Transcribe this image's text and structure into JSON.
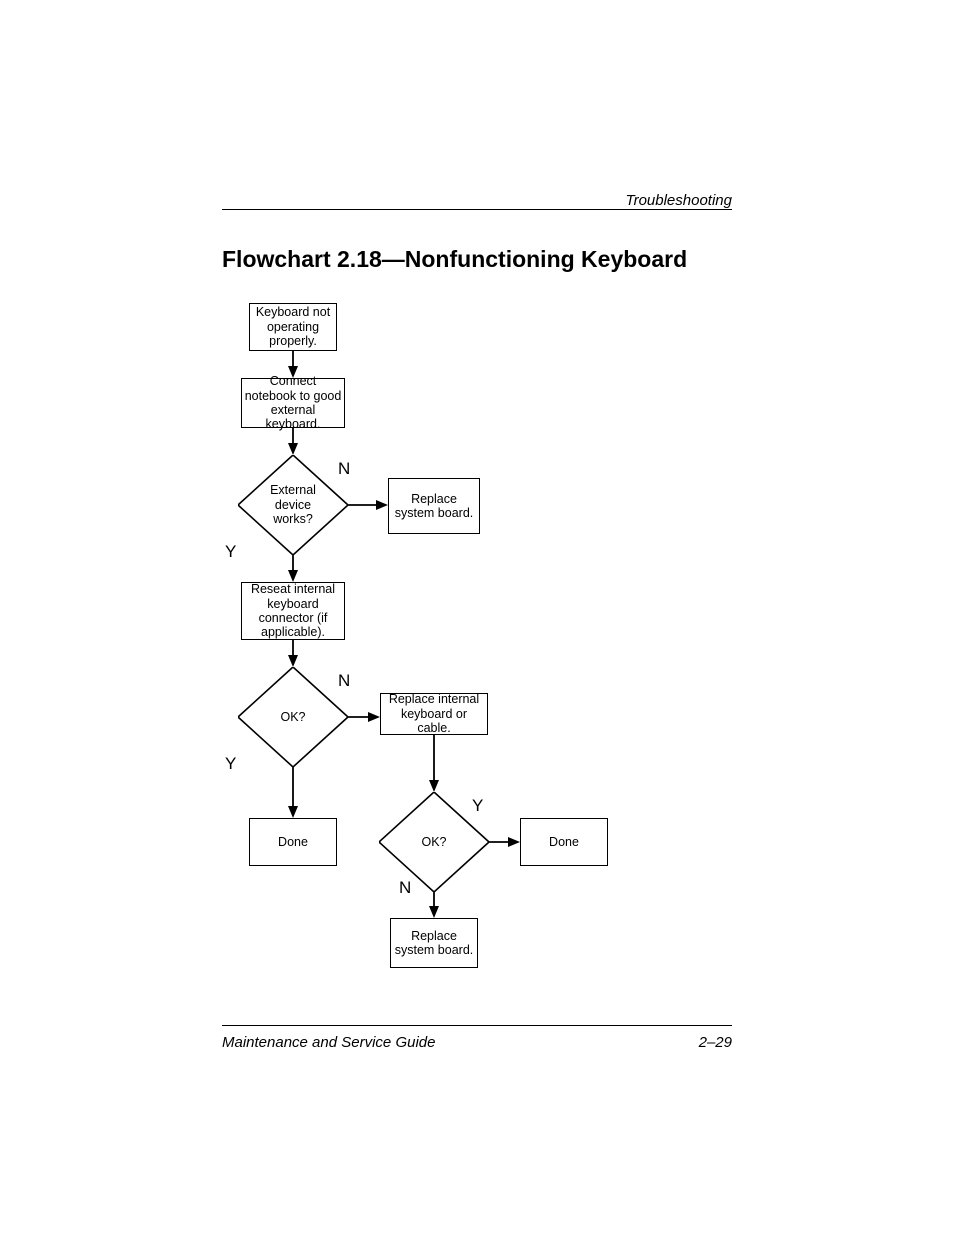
{
  "header": {
    "section": "Troubleshooting"
  },
  "title": "Flowchart 2.18—Nonfunctioning Keyboard",
  "flow": {
    "start": "Keyboard not operating properly.",
    "connect": "Connect notebook to good external keyboard.",
    "decision1": "External device works?",
    "d1_no": "N",
    "d1_yes": "Y",
    "replace_sb1": "Replace system board.",
    "reseat": "Reseat internal keyboard connector (if applicable).",
    "decision2": "OK?",
    "d2_no": "N",
    "d2_yes": "Y",
    "done1": "Done",
    "replace_kb": "Replace internal keyboard or cable.",
    "decision3": "OK?",
    "d3_yes": "Y",
    "d3_no": "N",
    "done2": "Done",
    "replace_sb2": "Replace system board."
  },
  "footer": {
    "left": "Maintenance and Service Guide",
    "right": "2–29"
  }
}
